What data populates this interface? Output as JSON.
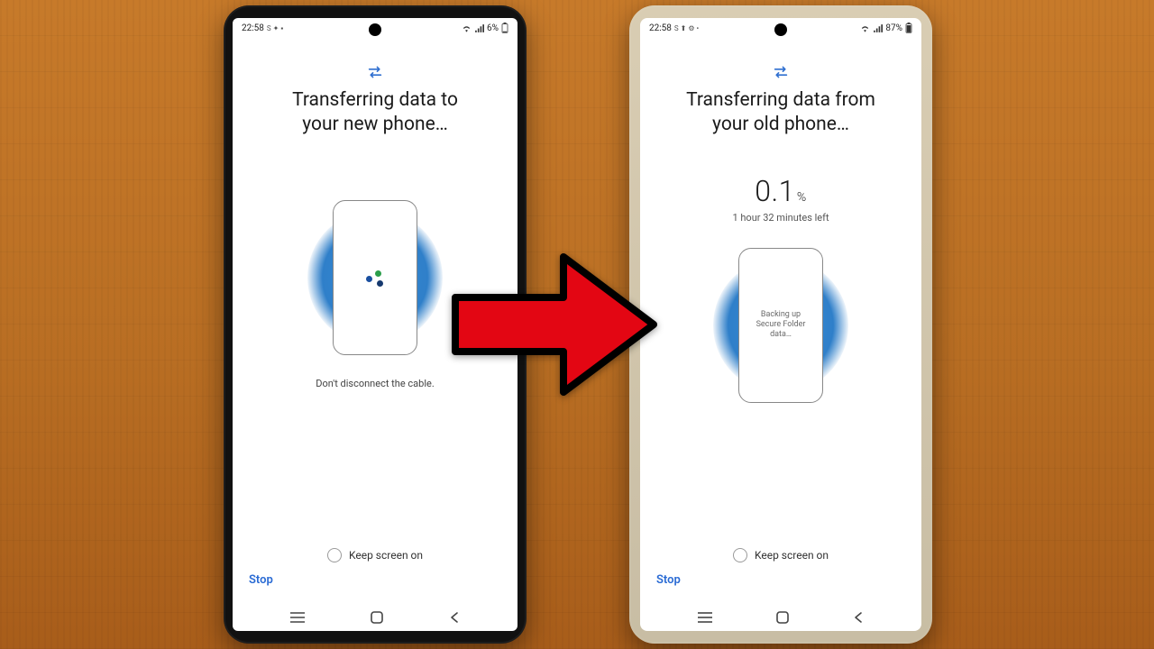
{
  "left": {
    "status": {
      "time": "22:58",
      "indicators": "S ✦ ▪",
      "battery": "6%"
    },
    "title": "Transferring data to\nyour new phone…",
    "hint": "Don't disconnect the cable.",
    "keep_screen": "Keep screen on",
    "stop": "Stop"
  },
  "right": {
    "status": {
      "time": "22:58",
      "indicators": "S ⬆ ⚙ •",
      "battery": "87%"
    },
    "title": "Transferring data from\nyour old phone…",
    "progress_value": "0.1",
    "progress_unit": "%",
    "time_left": "1 hour 32 minutes left",
    "inner_text": "Backing up\nSecure Folder\ndata…",
    "keep_screen": "Keep screen on",
    "stop": "Stop"
  },
  "icons": {
    "swap": "transfer-icon",
    "wifi": "wifi-icon",
    "signal": "signal-icon",
    "battery": "battery-icon"
  }
}
